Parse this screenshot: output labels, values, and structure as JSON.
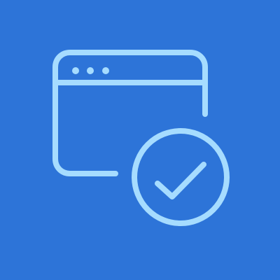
{
  "app": {
    "icon_name": "browser-window-check-icon",
    "colors": {
      "background": "#2d74d8",
      "line": "#a6dcff"
    },
    "parts": [
      "browser-window-icon",
      "window-dots-icon",
      "check-circle-icon",
      "checkmark-icon"
    ]
  }
}
